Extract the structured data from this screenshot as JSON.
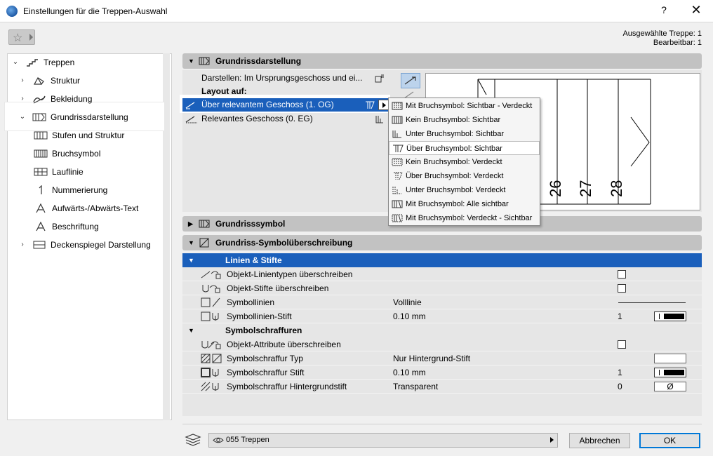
{
  "window": {
    "title": "Einstellungen für die Treppen-Auswahl",
    "help_label": "?",
    "close_label": "✕"
  },
  "selection_info": {
    "line1": "Ausgewählte Treppe: 1",
    "line2": "Bearbeitbar: 1"
  },
  "tree": {
    "items": [
      {
        "label": "Treppen",
        "icon": "stair-icon",
        "expander": "⌄"
      },
      {
        "label": "Struktur",
        "icon": "structure-icon",
        "expander": "›"
      },
      {
        "label": "Bekleidung",
        "icon": "cladding-icon",
        "expander": "›"
      },
      {
        "label": "Grundrissdarstellung",
        "icon": "floorplan-icon",
        "expander": "⌄"
      },
      {
        "label": "Stufen und Struktur",
        "icon": "steps-icon"
      },
      {
        "label": "Bruchsymbol",
        "icon": "break-symbol-icon"
      },
      {
        "label": "Lauflinie",
        "icon": "walkline-icon"
      },
      {
        "label": "Nummerierung",
        "icon": "numbering-icon"
      },
      {
        "label": "Aufwärts-/Abwärts-Text",
        "icon": "updown-text-icon"
      },
      {
        "label": "Beschriftung",
        "icon": "label-icon"
      },
      {
        "label": "Deckenspiegel Darstellung",
        "icon": "ceiling-icon",
        "expander": "›"
      }
    ]
  },
  "sections": {
    "grundrissdarstellung": "Grundrissdarstellung",
    "grundrisssymbol": "Grundrisssymbol",
    "ueberschreibung": "Grundriss-Symbolüberschreibung"
  },
  "grundriss": {
    "darstellen": "Darstellen: Im Ursprungsgeschoss und ei...",
    "layout_auf": "Layout auf:",
    "ueber": "Über relevantem Geschoss (1. OG)",
    "relevant": "Relevantes Geschoss (0. EG)"
  },
  "preview": {
    "numbers": [
      "26",
      "27",
      "28"
    ]
  },
  "menu": {
    "items": [
      "Mit Bruchsymbol: Sichtbar - Verdeckt",
      "Kein Bruchsymbol: Sichtbar",
      "Unter Bruchsymbol: Sichtbar",
      "Über Bruchsymbol: Sichtbar",
      "Kein Bruchsymbol: Verdeckt",
      "Über Bruchsymbol: Verdeckt",
      "Unter Bruchsymbol: Verdeckt",
      "Mit Bruchsymbol: Alle sichtbar",
      "Mit Bruchsymbol: Verdeckt - Sichtbar"
    ],
    "highlighted_index": 3
  },
  "linien": {
    "header": "Linien & Stifte",
    "rows": [
      {
        "label": "Objekt-Linientypen überschreiben",
        "checked": false
      },
      {
        "label": "Objekt-Stifte überschreiben",
        "checked": false
      },
      {
        "label": "Symbollinien",
        "value": "Volllinie"
      },
      {
        "label": "Symbollinien-Stift",
        "value": "0.10 mm",
        "num": "1"
      }
    ]
  },
  "schraffuren": {
    "header": "Symbolschraffuren",
    "rows": [
      {
        "label": "Objekt-Attribute überschreiben",
        "checked": false
      },
      {
        "label": "Symbolschraffur Typ",
        "value": "Nur Hintergrund-Stift"
      },
      {
        "label": "Symbolschraffur Stift",
        "value": "0.10 mm",
        "num": "1"
      },
      {
        "label": "Symbolschraffur Hintergrundstift",
        "value": "Transparent",
        "num": "0",
        "symbol": "Ø"
      }
    ]
  },
  "footer": {
    "layer": "055 Treppen",
    "cancel": "Abbrechen",
    "ok": "OK"
  },
  "colors": {
    "accent": "#1a5fbb",
    "header_gray": "#c2c2c2"
  }
}
